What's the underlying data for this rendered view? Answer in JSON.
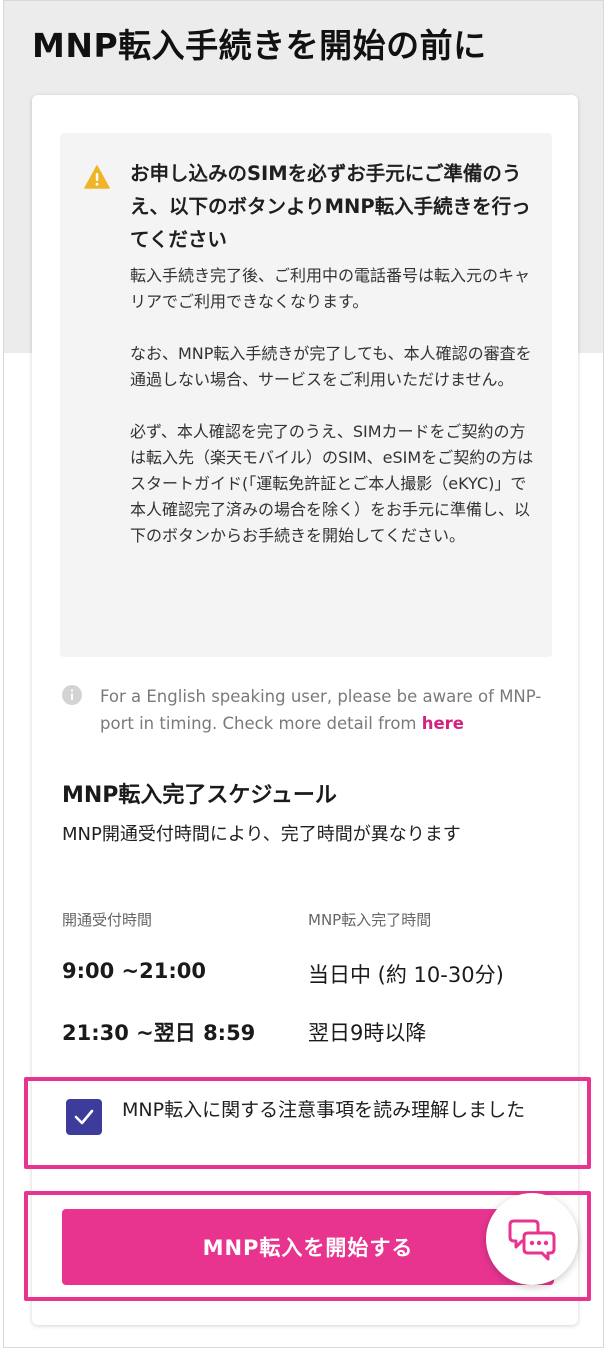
{
  "page": {
    "title": "MNP転入手続きを開始の前に"
  },
  "notice": {
    "icon": "warning-triangle-icon",
    "heading": "お申し込みのSIMを必ずお手元にご準備のうえ、以下のボタンよりMNP転入手続きを行ってください",
    "paragraphs": [
      "転入手続き完了後、ご利用中の電話番号は転入元のキャリアでご利用できなくなります。",
      "なお、MNP転入手続きが完了しても、本人確認の審査を通過しない場合、サービスをご利用いただけません。",
      "必ず、本人確認を完了のうえ、SIMカードをご契約の方は転入先（楽天モバイル）のSIM、eSIMをご契約の方はスタートガイド(「運転免許証とご本人撮影（eKYC)」で本人確認完了済みの場合を除く）をお手元に準備し、以下のボタンからお手続きを開始してください。"
    ]
  },
  "info": {
    "icon": "info-circle-icon",
    "text": "For a English speaking user, please be aware of MNP-port in timing.  Check more detail from ",
    "link_label": "here"
  },
  "schedule": {
    "title": "MNP転入完了スケジュール",
    "subtitle": "MNP開通受付時間により、完了時間が異なります",
    "col_reception": "開通受付時間",
    "col_completion": "MNP転入完了時間",
    "rows": [
      {
        "reception": "9:00 ~21:00",
        "completion": "当日中 (約 10-30分)"
      },
      {
        "reception": "21:30 ~翌日 8:59",
        "completion": "翌日9時以降"
      }
    ]
  },
  "agreement": {
    "checked": true,
    "label": "MNP転入に関する注意事項を読み理解しました"
  },
  "cta": {
    "label": "MNP転入を開始する"
  },
  "chat": {
    "icon": "chat-bubbles-icon"
  },
  "colors": {
    "accent": "#e8348f",
    "checkbox": "#3e3c9a",
    "warning": "#f0b429",
    "link": "#d4237f"
  }
}
